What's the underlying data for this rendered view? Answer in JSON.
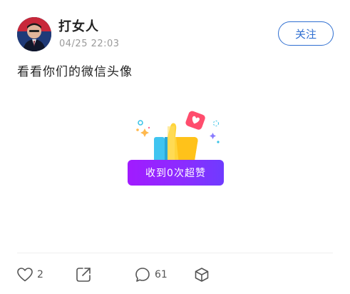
{
  "post": {
    "username": "打女人",
    "timestamp": "04/25 22:03",
    "follow_label": "关注",
    "text": "看看你们的微信头像",
    "super_like_label": "收到0次超赞"
  },
  "actions": {
    "like_count": "2",
    "comment_count": "61"
  },
  "icons": {
    "avatar": "avatar",
    "like": "heart-icon",
    "share": "share-icon",
    "comment": "comment-icon",
    "more": "cube-icon",
    "thumbs_up": "thumbs-up-icon"
  },
  "colors": {
    "accent_blue": "#2f6fd1",
    "super_like_purple": "#8a2dff"
  }
}
